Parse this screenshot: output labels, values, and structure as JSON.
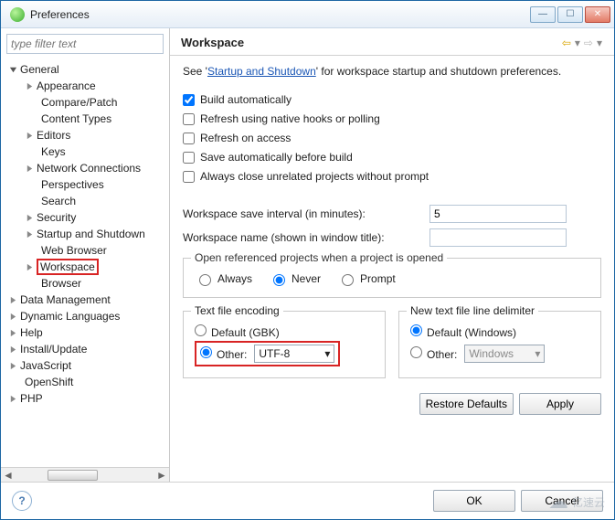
{
  "window": {
    "title": "Preferences"
  },
  "filter": {
    "placeholder": "type filter text"
  },
  "tree": {
    "general": "General",
    "items1": [
      "Appearance",
      "Compare/Patch",
      "Content Types",
      "Editors",
      "Keys",
      "Network Connections",
      "Perspectives",
      "Search",
      "Security",
      "Startup and Shutdown",
      "Web Browser",
      "Workspace"
    ],
    "browser": "Browser",
    "items0": [
      "Data Management",
      "Dynamic Languages",
      "Help",
      "Install/Update",
      "JavaScript",
      "OpenShift",
      "PHP"
    ]
  },
  "page": {
    "title": "Workspace",
    "intro_pre": "See '",
    "intro_link": "Startup and Shutdown",
    "intro_post": "' for workspace startup and shutdown preferences.",
    "chk": {
      "build": "Build automatically",
      "refresh_native": "Refresh using native hooks or polling",
      "refresh_access": "Refresh on access",
      "save_before": "Save automatically before build",
      "close_unrelated": "Always close unrelated projects without prompt"
    },
    "interval_label": "Workspace save interval (in minutes):",
    "interval_value": "5",
    "wsname_label": "Workspace name (shown in window title):",
    "wsname_value": "",
    "openref": {
      "legend": "Open referenced projects when a project is opened",
      "always": "Always",
      "never": "Never",
      "prompt": "Prompt"
    },
    "enc": {
      "legend": "Text file encoding",
      "default": "Default (GBK)",
      "other": "Other:",
      "other_value": "UTF-8"
    },
    "delim": {
      "legend": "New text file line delimiter",
      "default": "Default (Windows)",
      "other": "Other:",
      "other_value": "Windows"
    },
    "restore": "Restore Defaults",
    "apply": "Apply"
  },
  "footer": {
    "ok": "OK",
    "cancel": "Cancel"
  },
  "watermark": "亿速云"
}
